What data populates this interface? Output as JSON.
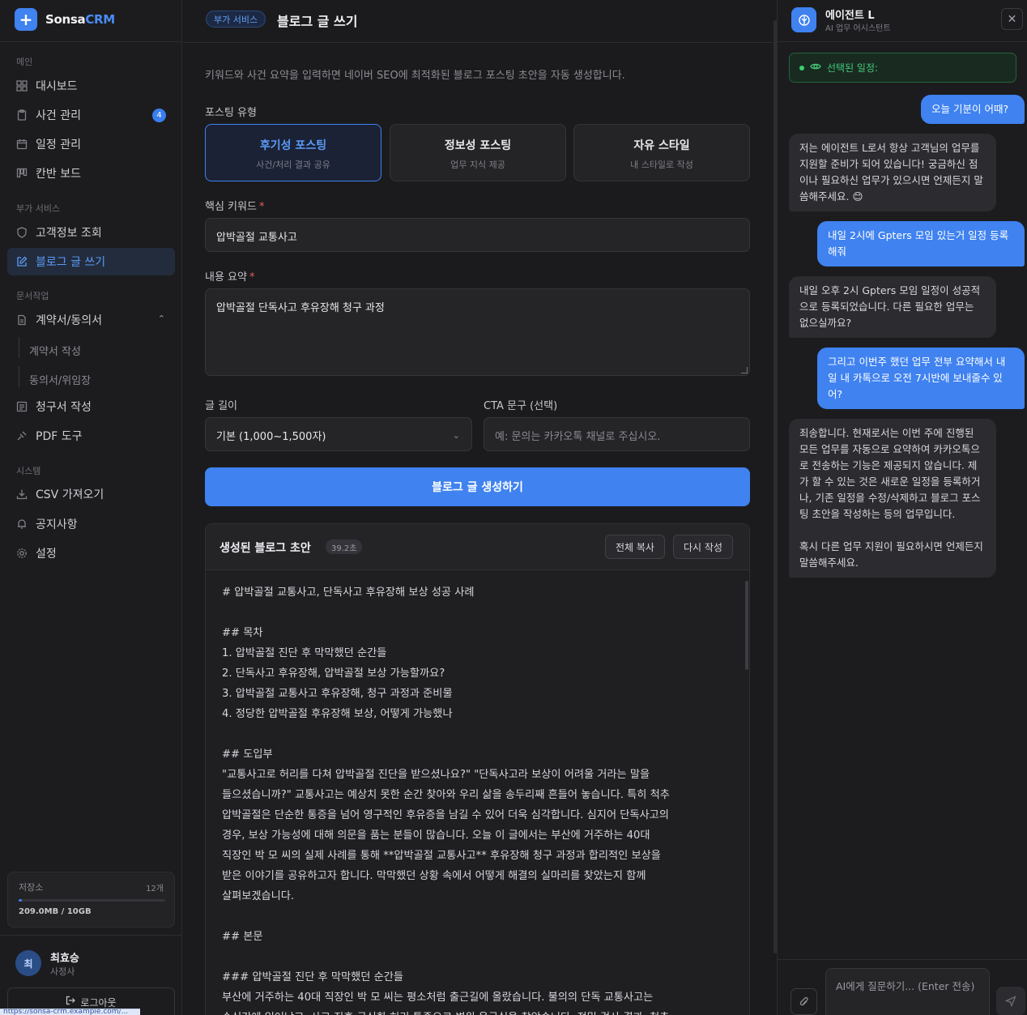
{
  "app": {
    "logo_mark": "+",
    "brand_main": "Sonsa",
    "brand_accent": "CRM",
    "accent_color": "#3f82f0"
  },
  "sidebar": {
    "sections": {
      "main": "메인",
      "extra": "부가 서비스",
      "docs": "문서작업",
      "system": "시스템"
    },
    "items": {
      "dashboard": {
        "label": "대시보드",
        "icon": "grid-icon"
      },
      "cases": {
        "label": "사건 관리",
        "icon": "clipboard-icon",
        "badge": "4"
      },
      "schedule": {
        "label": "일정 관리",
        "icon": "calendar-icon"
      },
      "kanban": {
        "label": "칸반 보드",
        "icon": "kanban-icon"
      },
      "customer": {
        "label": "고객정보 조회",
        "icon": "shield-icon"
      },
      "blog": {
        "label": "블로그 글 쓰기",
        "icon": "edit-icon"
      },
      "contracts": {
        "label": "계약서/동의서",
        "icon": "document-icon"
      },
      "contract_write": {
        "label": "계약서 작성"
      },
      "consent": {
        "label": "동의서/위임장"
      },
      "invoice": {
        "label": "청구서 작성",
        "icon": "receipt-icon"
      },
      "pdf": {
        "label": "PDF 도구",
        "icon": "pdf-icon"
      },
      "csv": {
        "label": "CSV 가져오기",
        "icon": "download-icon"
      },
      "notice": {
        "label": "공지사항",
        "icon": "bell-icon"
      },
      "settings": {
        "label": "설정",
        "icon": "gear-icon"
      }
    },
    "storage": {
      "label": "저장소",
      "count": "12개",
      "used": "209.0MB / 10GB",
      "fraction": 0.02
    },
    "user": {
      "initial": "최",
      "name": "최효승",
      "role": "사정사"
    },
    "logout": "로그아웃",
    "status_url": "https://sonsa-crm.example.com/..."
  },
  "main": {
    "category": "부가 서비스",
    "title": "블로그 글 쓰기",
    "description": "키워드와 사건 요약을 입력하면 네이버 SEO에 최적화된 블로그 포스팅 초안을 자동 생성합니다.",
    "type_label": "포스팅 유형",
    "types": [
      {
        "title": "후기성 포스팅",
        "sub": "사건/처리 결과 공유",
        "selected": true
      },
      {
        "title": "정보성 포스팅",
        "sub": "업무 지식 제공",
        "selected": false
      },
      {
        "title": "자유 스타일",
        "sub": "내 스타일로 작성",
        "selected": false
      }
    ],
    "keyword_label": "핵심 키워드",
    "keyword_value": "압박골절 교통사고",
    "summary_label": "내용 요약",
    "summary_value": "압박골절 단독사고 후유장해 청구 과정",
    "length_label": "글 길이",
    "length_value": "기본 (1,000~1,500자)",
    "cta_label": "CTA 문구 (선택)",
    "cta_placeholder": "예: 문의는 카카오톡 채널로 주십시오.",
    "required_mark": "*",
    "generate_button": "블로그 글 생성하기",
    "result": {
      "title": "생성된 블로그 초안",
      "time": "39.2초",
      "copy_button": "전체 복사",
      "rewrite_button": "다시 작성",
      "lines": [
        "# 압박골절 교통사고, 단독사고 후유장해 보상 성공 사례",
        "",
        "## 목차",
        "1.  압박골절 진단 후 막막했던 순간들",
        "2.  단독사고 후유장해, 압박골절 보상 가능할까요?",
        "3.  압박골절 교통사고 후유장해, 청구 과정과 준비물",
        "4.  정당한 압박골절 후유장해 보상, 어떻게 가능했나",
        "",
        "## 도입부",
        "\"교통사고로 허리를 다쳐 압박골절 진단을 받으셨나요?\" \"단독사고라 보상이 어려울 거라는 말을",
        "들으셨습니까?\" 교통사고는 예상치 못한 순간 찾아와 우리 삶을 송두리째 흔들어 놓습니다. 특히 척추",
        "압박골절은 단순한 통증을 넘어 영구적인 후유증을 남길 수 있어 더욱 심각합니다. 심지어 단독사고의",
        "경우, 보상 가능성에 대해 의문을 품는 분들이 많습니다. 오늘 이 글에서는 부산에 거주하는 40대",
        "직장인 박 모 씨의 실제 사례를 통해 **압박골절 교통사고** 후유장해 청구 과정과 합리적인 보상을",
        "받은 이야기를 공유하고자 합니다. 막막했던 상황 속에서 어떻게 해결의 실마리를 찾았는지 함께",
        "살펴보겠습니다.",
        "",
        "## 본문",
        "",
        "### 압박골절 진단 후 막막했던 순간들",
        "부산에 거주하는 40대 직장인 박 모 씨는 평소처럼 출근길에 올랐습니다. 불의의 단독 교통사고는",
        "순식간에 일어났고, 사고 직후 극심한 허리 통증으로 병원 응급실을 찾았습니다. 정밀 검사 결과, 척추"
      ]
    }
  },
  "agent": {
    "icon": "agent-icon",
    "name": "에이전트 L",
    "subtitle": "AI 업무 어시스턴트",
    "selected_schedule": "선택된 일정:",
    "messages": [
      {
        "role": "user",
        "text": "오늘 기분이 어때?"
      },
      {
        "role": "bot",
        "text": "저는 에이전트 L로서 항상 고객님의 업무를 지원할 준비가 되어 있습니다! 궁금하신 점이나 필요하신 업무가 있으시면 언제든지 말씀해주세요. 😊"
      },
      {
        "role": "user",
        "text": "내일 2시에 Gpters 모임 있는거 일정 등록해줘"
      },
      {
        "role": "bot",
        "text": "내일 오후 2시 Gpters 모임 일정이 성공적으로 등록되었습니다. 다른 필요한 업무는 없으실까요?"
      },
      {
        "role": "user",
        "text": "그리고 이번주 했던 업무 전부 요약해서 내일 내 카톡으로 오전 7시반에 보내줄수 있어?"
      },
      {
        "role": "bot",
        "text": "죄송합니다. 현재로서는 이번 주에 진행된 모든 업무를 자동으로 요약하여 카카오톡으로 전송하는 기능은 제공되지 않습니다. 제가 할 수 있는 것은 새로운 일정을 등록하거나, 기존 일정을 수정/삭제하고 블로그 포스팅 초안을 작성하는 등의 업무입니다.\n\n혹시 다른 업무 지원이 필요하시면 언제든지 말씀해주세요."
      }
    ],
    "input_placeholder": "AI에게 질문하기... (Enter 전송)"
  }
}
